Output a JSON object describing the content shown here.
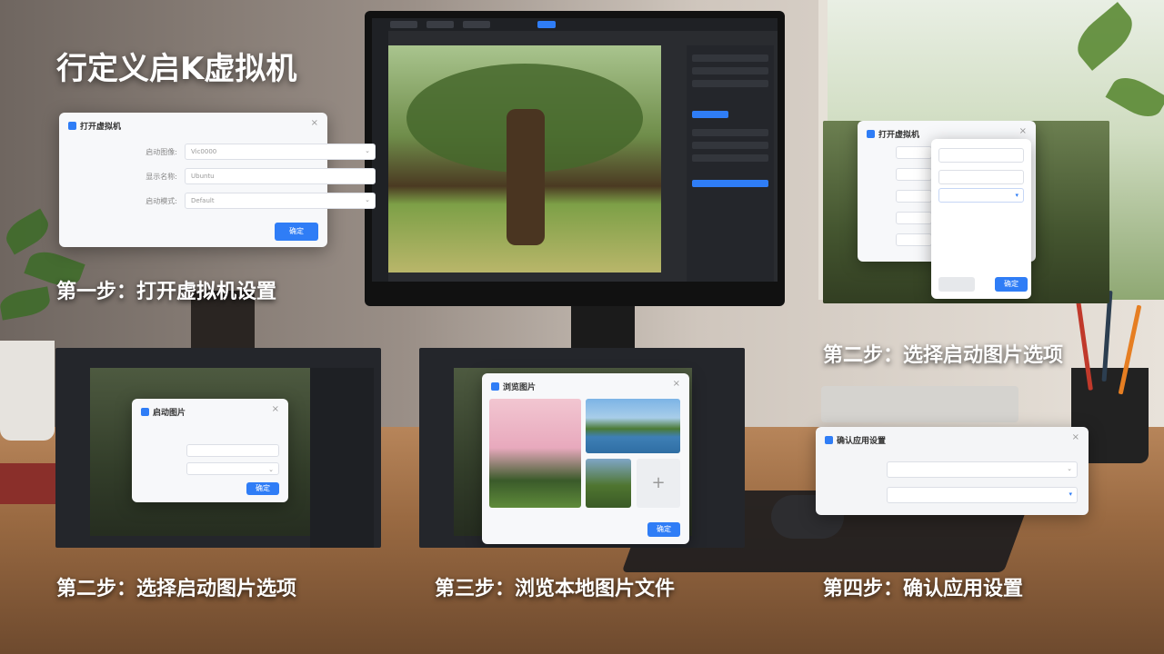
{
  "title": "行定义启K虚拟机",
  "captions": {
    "step1": "第一步：打开虚拟机设置",
    "step2a": "第二步：选择启动图片选项",
    "step2b": "第二步：选择启动图片选项",
    "step3": "第三步：浏览本地图片文件",
    "step4": "第四步：确认应用设置"
  },
  "colors": {
    "accent": "#2f7df6",
    "caption": "#ffffff"
  },
  "dialog1": {
    "title": "打开虚拟机",
    "close": "×",
    "fields": [
      {
        "label": "启动图像:",
        "value": "Vic0000"
      },
      {
        "label": "显示名称:",
        "value": "Ubuntu"
      },
      {
        "label": "启动模式:",
        "value": "Default"
      }
    ],
    "button": "确定"
  },
  "dialog2": {
    "title": "打开虚拟机",
    "close": "×",
    "button": "确定"
  },
  "dialog2b": {
    "title": "启动图片",
    "close": "×",
    "button": "确定"
  },
  "dialog3": {
    "title": "浏览图片",
    "close": "×",
    "add": "+",
    "button": "确定"
  },
  "dialog4": {
    "title": "确认应用设置",
    "close": "×"
  }
}
